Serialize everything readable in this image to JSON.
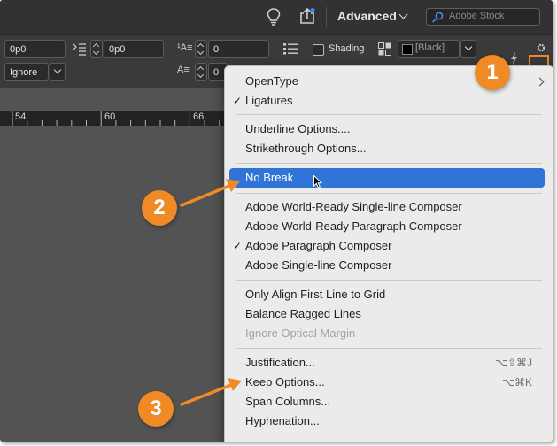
{
  "topbar": {
    "workspace_label": "Advanced",
    "search_placeholder": "Adobe Stock"
  },
  "control": {
    "field_1": "0p0",
    "field_2": "0p0",
    "field_3": "0",
    "field_4": "0",
    "ignore_value": "Ignore",
    "shading_label": "Shading",
    "swatch_label": "[Black]"
  },
  "ruler": {
    "ticks": [
      "54",
      "60",
      "66"
    ]
  },
  "menu": {
    "items": [
      {
        "label": "OpenType",
        "checked": false,
        "submenu": true
      },
      {
        "label": "Ligatures",
        "checked": true
      },
      {
        "label": "Underline Options...."
      },
      {
        "label": "Strikethrough Options..."
      },
      {
        "label": "No Break"
      },
      {
        "label": "Adobe World-Ready Single-line Composer"
      },
      {
        "label": "Adobe World-Ready Paragraph Composer"
      },
      {
        "label": "Adobe Paragraph Composer",
        "checked": true
      },
      {
        "label": "Adobe Single-line Composer"
      },
      {
        "label": "Only Align First Line to Grid"
      },
      {
        "label": "Balance Ragged Lines"
      },
      {
        "label": "Ignore Optical Margin",
        "disabled": true
      },
      {
        "label": "Justification...",
        "shortcut": "⌥⇧⌘J"
      },
      {
        "label": "Keep Options...",
        "shortcut": "⌥⌘K"
      },
      {
        "label": "Span Columns..."
      },
      {
        "label": "Hyphenation..."
      }
    ]
  },
  "callouts": [
    "1",
    "2",
    "3"
  ],
  "colors": {
    "accent_orange": "#f08a24",
    "highlight_blue": "#2f74d6"
  },
  "icons": [
    "lightbulb-icon",
    "share-icon",
    "search-icon",
    "checkmark-icon",
    "submenu-arrow-icon",
    "mouse-cursor-icon",
    "gear-icon",
    "lightning-icon"
  ]
}
